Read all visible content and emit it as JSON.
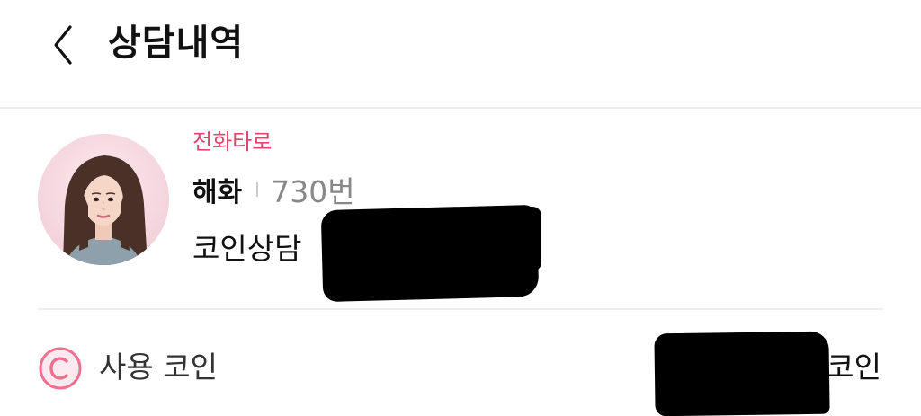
{
  "header": {
    "back_icon": "chevron-left-icon",
    "title": "상담내역"
  },
  "consultation": {
    "avatar_icon": "counselor-avatar",
    "service_type": "전화타로",
    "counselor_name": "해화",
    "counselor_number": "730번",
    "consult_method": "코인상담"
  },
  "usage": {
    "coin_icon": "coin-c-icon",
    "label": "사용 코인",
    "value_suffix": "0코인"
  },
  "colors": {
    "accent": "#e0456e",
    "coin_icon": "#f07090",
    "divider": "#eeeeee"
  }
}
